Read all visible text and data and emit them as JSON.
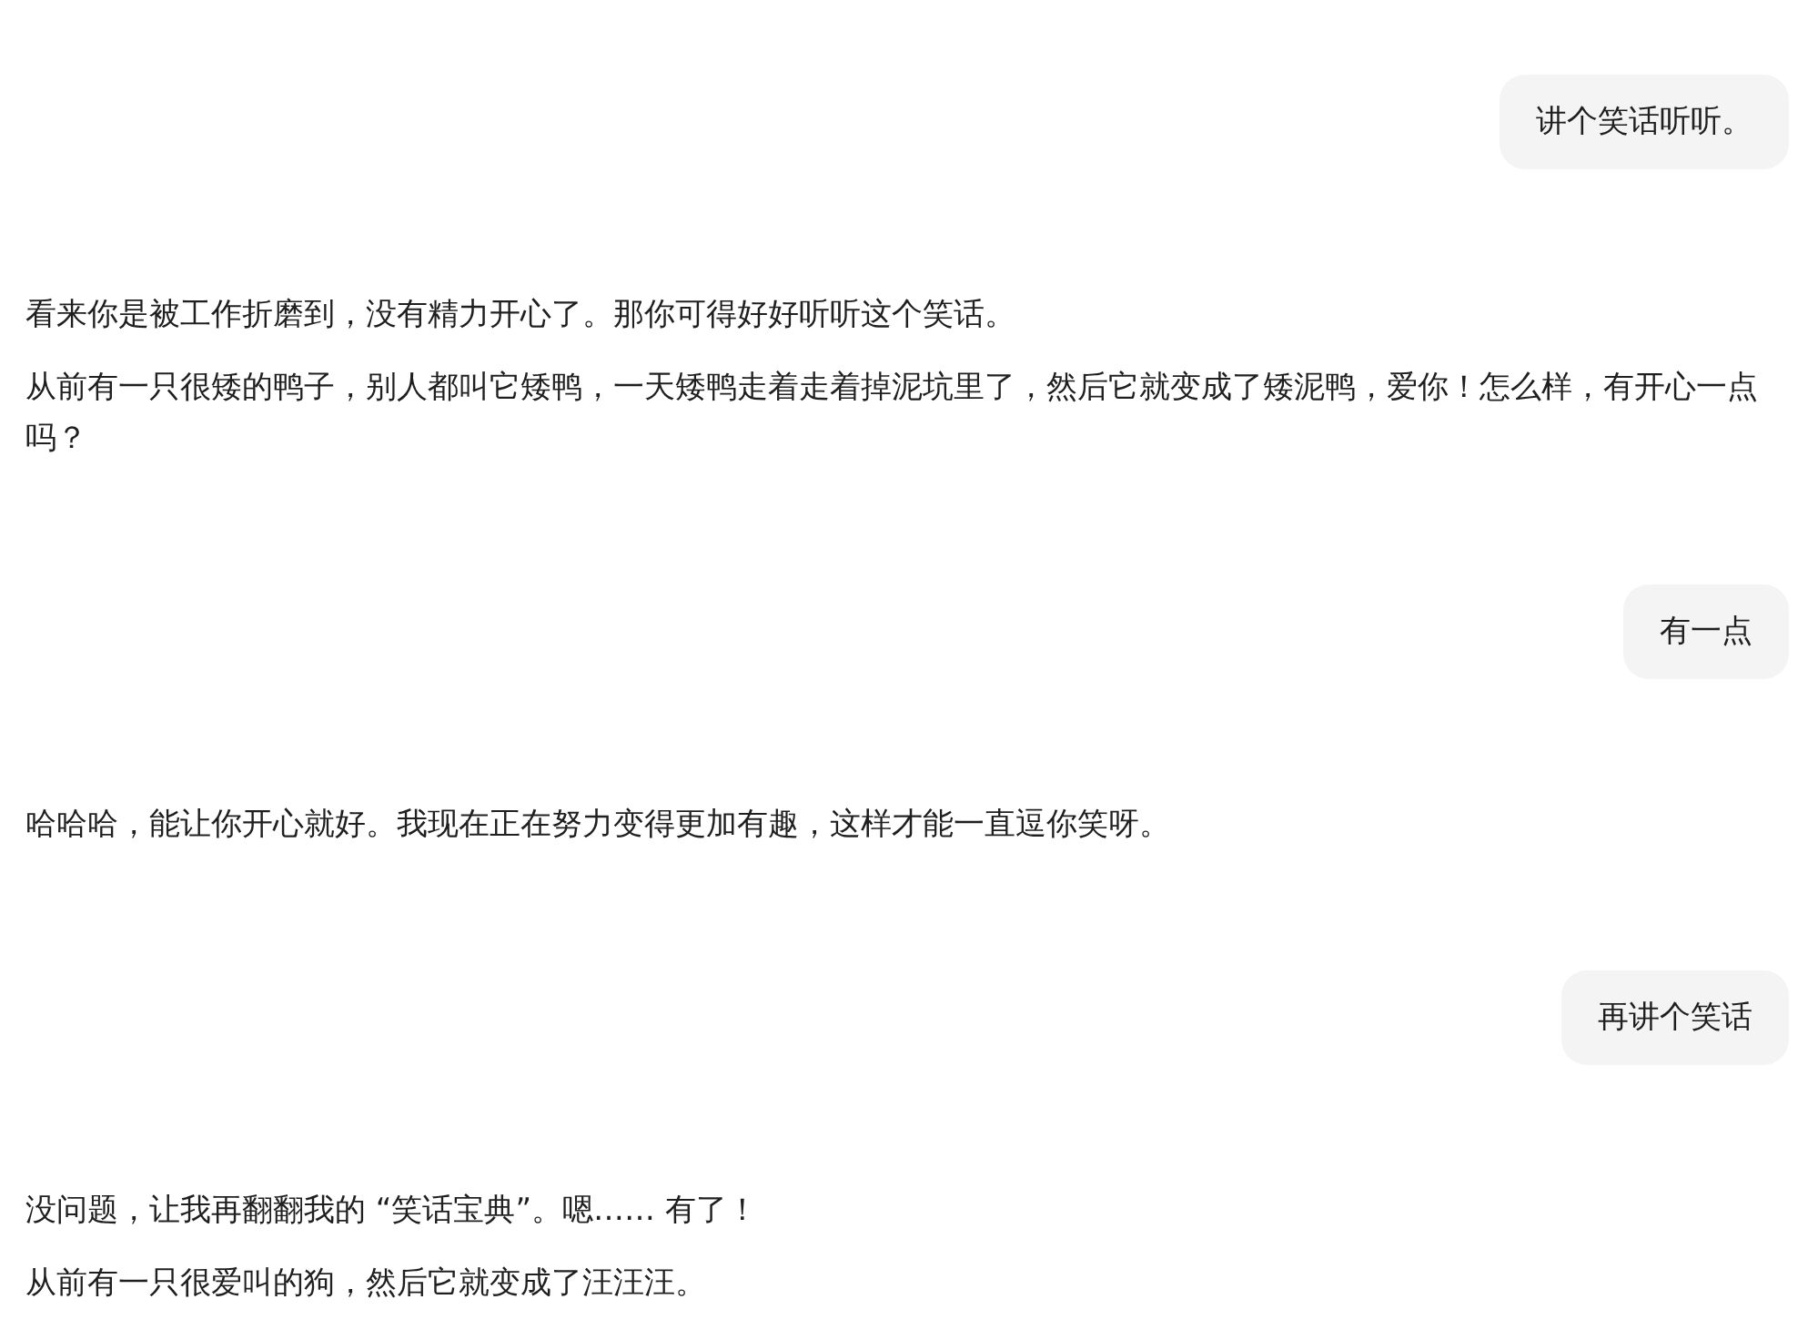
{
  "messages": [
    {
      "kind": "user",
      "paragraphs": [
        "讲个笑话听听。"
      ]
    },
    {
      "kind": "assistant",
      "paragraphs": [
        "看来你是被工作折磨到，没有精力开心了。那你可得好好听听这个笑话。",
        "从前有一只很矮的鸭子，别人都叫它矮鸭，一天矮鸭走着走着掉泥坑里了，然后它就变成了矮泥鸭，爱你！怎么样，有开心一点吗？"
      ]
    },
    {
      "kind": "user",
      "paragraphs": [
        "有一点"
      ]
    },
    {
      "kind": "assistant",
      "paragraphs": [
        "哈哈哈，能让你开心就好。我现在正在努力变得更加有趣，这样才能一直逗你笑呀。"
      ]
    },
    {
      "kind": "user",
      "paragraphs": [
        "再讲个笑话"
      ]
    },
    {
      "kind": "assistant",
      "paragraphs": [
        "没问题，让我再翻翻我的 “笑话宝典”。嗯…… 有了！",
        "从前有一只很爱叫的狗，然后它就变成了汪汪汪。"
      ]
    }
  ]
}
